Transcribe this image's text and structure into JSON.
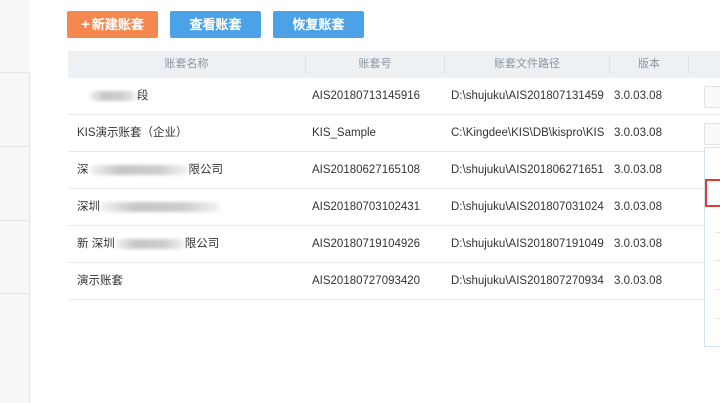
{
  "toolbar": {
    "new_label": "新建账套",
    "view_label": "查看账套",
    "restore_label": "恢复账套",
    "new_icon": "plus-icon",
    "colors": {
      "new": "#f4884e",
      "view": "#4ca2e6",
      "restore": "#4ca2e6"
    }
  },
  "table": {
    "headers": [
      "账套名称",
      "账套号",
      "账套文件路径",
      "版本"
    ],
    "rows": [
      {
        "name_suffix": "段",
        "code": "AIS20180713145916",
        "path": "D:\\shujuku\\AIS201807131459",
        "version": "3.0.03.08"
      },
      {
        "name": "KIS演示账套（企业）",
        "code": "KIS_Sample",
        "path": "C:\\Kingdee\\KIS\\DB\\kispro\\KIS",
        "version": "3.0.03.08"
      },
      {
        "name_prefix": "深",
        "name_suffix": "限公司",
        "code": "AIS20180627165108",
        "path": "D:\\shujuku\\AIS201806271651",
        "version": "3.0.03.08"
      },
      {
        "name_prefix": "深圳",
        "code": "AIS20180703102431",
        "path": "D:\\shujuku\\AIS201807031024",
        "version": "3.0.03.08"
      },
      {
        "name_prefix": "新 深圳",
        "name_suffix": "限公司",
        "code": "AIS20180719104926",
        "path": "D:\\shujuku\\AIS201807191049",
        "version": "3.0.03.08"
      },
      {
        "name": "演示账套",
        "code": "AIS20180727093420",
        "path": "D:\\shujuku\\AIS201807270934",
        "version": "3.0.03.08"
      }
    ]
  },
  "highlight_color": "#e33b3b"
}
